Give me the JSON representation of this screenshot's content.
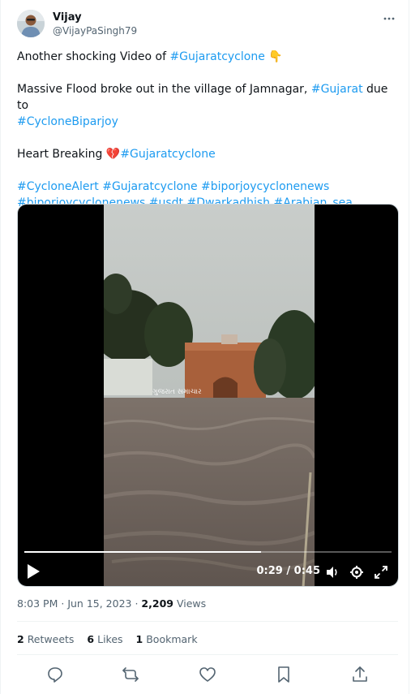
{
  "author": {
    "name": "Vijay",
    "handle": "@VijayPaSingh79"
  },
  "tweet": {
    "line1_text": "Another shocking Video of ",
    "line1_tag": "#Gujaratcyclone",
    "line1_emoji": "👇",
    "line2_text": "Massive Flood broke out in the village of Jamnagar, ",
    "line2_tag": "#Gujarat",
    "line2_text_after": " due to",
    "line3_tag": "#CycloneBiparjoy",
    "line4_text": "Heart Breaking ",
    "line4_emoji": "💔",
    "line4_tag": "#Gujaratcyclone",
    "hashtags_row1": [
      "#CycloneAlert",
      "#Gujaratcyclone",
      "#biporjoycyclonenews"
    ],
    "hashtags_row2": [
      "#biporjoycyclonenews",
      "#usdt",
      "#Dwarkadhish",
      "#Arabian_sea"
    ]
  },
  "video": {
    "overlay_caption": "ગુજરાત સમાચાર",
    "current_time": "0:29",
    "duration": "0:45",
    "progress_fraction": 0.644
  },
  "meta": {
    "time": "8:03 PM",
    "date": "Jun 15, 2023",
    "views_count": "2,209",
    "views_label": "Views"
  },
  "stats": {
    "retweets_count": "2",
    "retweets_label": "Retweets",
    "likes_count": "6",
    "likes_label": "Likes",
    "bookmarks_count": "1",
    "bookmarks_label": "Bookmark"
  },
  "colors": {
    "link": "#1d9bf0",
    "text": "#0f1419",
    "secondary": "#536471"
  },
  "icons": {
    "more": "more-horizontal-icon",
    "reply": "reply-icon",
    "retweet": "retweet-icon",
    "like": "heart-icon",
    "bookmark": "bookmark-icon",
    "share": "share-icon",
    "play": "play-icon",
    "volume": "volume-icon",
    "settings": "gear-icon",
    "fullscreen": "fullscreen-icon"
  }
}
